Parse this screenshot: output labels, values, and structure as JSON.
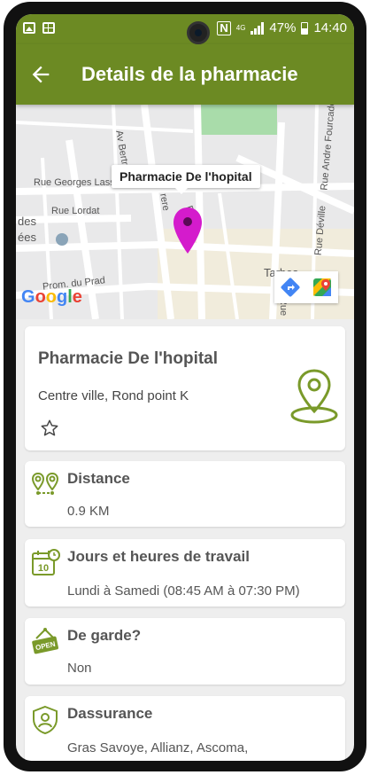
{
  "status_bar": {
    "network": "4G",
    "battery": "47%",
    "time": "14:40"
  },
  "app_bar": {
    "title": "Details de la pharmacie"
  },
  "map": {
    "streets": [
      "Rue Georges Lassalle",
      "Rue Lordat",
      "Av Bertrand",
      "Rue Andre Fourcade",
      "Rue Déville",
      "Prom. du Prad",
      "Tarbes",
      "Rue",
      "Rue",
      "rere",
      "des",
      "ées"
    ],
    "marker_label": "Pharmacie De l'hopital",
    "logo": "Google",
    "pin_color": "#d41bcc"
  },
  "pharmacy": {
    "name": "Pharmacie De l'hopital",
    "address": "Centre ville, Rond point K"
  },
  "distance": {
    "title": "Distance",
    "value": "0.9 KM"
  },
  "hours": {
    "title": "Jours et heures de travail",
    "value": "Lundi à Samedi (08:45 AM à 07:30 PM)",
    "calendar_day": "10"
  },
  "garde": {
    "title": "De garde?",
    "value": "Non",
    "sign_text": "OPEN"
  },
  "assurance": {
    "title": "Dassurance",
    "value": "Gras Savoye, Allianz, Ascoma,"
  },
  "colors": {
    "primary": "#6c8a23",
    "icon": "#7a9a2a"
  }
}
